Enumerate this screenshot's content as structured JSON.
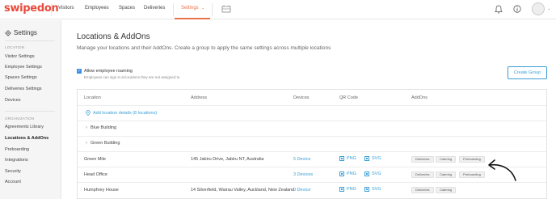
{
  "app": {
    "logo": "swipedon"
  },
  "nav": {
    "items": [
      "Visitors",
      "Employees",
      "Spaces",
      "Deliveries",
      "Settings"
    ],
    "active": "Settings"
  },
  "sidebar": {
    "title": "Settings",
    "section_location": "LOCATION",
    "location_items": [
      "Visitor Settings",
      "Employee Settings",
      "Spaces Settings",
      "Deliveries Settings",
      "Devices"
    ],
    "section_org": "ORGANIZATION",
    "org_items": [
      "Agreements Library",
      "Locations & AddOns",
      "Preboarding",
      "Integrations",
      "Security",
      "Account"
    ],
    "active": "Locations & AddOns"
  },
  "main": {
    "title": "Locations & AddOns",
    "description": "Manage your locations and their AddOns. Create a group to apply the same settings across multiple locations",
    "roaming_label": "Allow employee roaming",
    "roaming_sub": "Employees can sign in at locations they are not assigned to",
    "roaming_checked": true,
    "create_group": "Create Group"
  },
  "table": {
    "headers": [
      "Location",
      "Address",
      "Devices",
      "QR Code",
      "AddOns"
    ],
    "add_link": "Add location details (8 locations)",
    "groups": [
      "Blue Building",
      "Green Building"
    ],
    "rows": [
      {
        "location": "Green Mile",
        "address": "145 Jabiru Drive, Jabiru NT, Australia",
        "devices": "5 Device",
        "png": "PNG",
        "svg": "SVG",
        "addons": [
          "Deliveries",
          "Catering",
          "Preboarding"
        ]
      },
      {
        "location": "Head Office",
        "address": "",
        "devices": "3 Devices",
        "png": "PNG",
        "svg": "SVG",
        "addons": [
          "Deliveries",
          "Catering",
          "Preboarding"
        ]
      },
      {
        "location": "Humphrey House",
        "address": "14 Silverfield, Wairau Valley, Auckland, New Zealand",
        "devices": "0 Device",
        "png": "PNG",
        "svg": "SVG",
        "addons": [
          "Deliveries",
          "Catering"
        ]
      }
    ]
  },
  "colors": {
    "brand": "#e84b3c",
    "accent": "#e8734a",
    "link": "#3a9fd6",
    "check": "#3a8ee6"
  }
}
